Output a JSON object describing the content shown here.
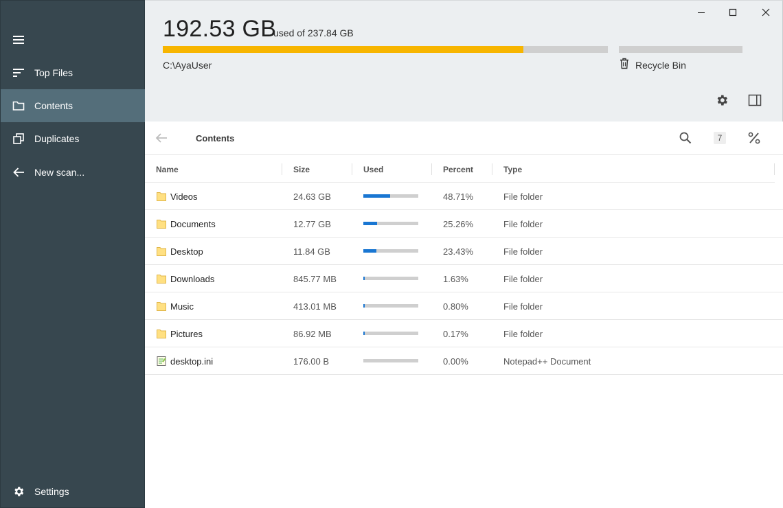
{
  "sidebar": {
    "menu_icon": "hamburger-menu-icon",
    "items": [
      {
        "label": "Top Files",
        "icon": "sort-lines-icon"
      },
      {
        "label": "Contents",
        "icon": "folder-outline-icon",
        "active": true
      },
      {
        "label": "Duplicates",
        "icon": "duplicate-icon"
      },
      {
        "label": "New scan...",
        "icon": "arrow-left-icon"
      }
    ],
    "settings_label": "Settings"
  },
  "header": {
    "used": "192.53 GB",
    "of_total": "used of 237.84 GB",
    "usage_fraction": 0.8095,
    "path": "C:\\AyaUser",
    "recycle_label": "Recycle Bin",
    "recycle_fraction": 0.0
  },
  "toolbar": {
    "title": "Contents",
    "count": "7"
  },
  "table": {
    "columns": [
      "Name",
      "Size",
      "Used",
      "Percent",
      "Type"
    ],
    "rows": [
      {
        "name": "Videos",
        "size": "24.63 GB",
        "used": 0.4871,
        "percent": "48.71%",
        "type": "File folder",
        "icon": "folder-icon"
      },
      {
        "name": "Documents",
        "size": "12.77 GB",
        "used": 0.2526,
        "percent": "25.26%",
        "type": "File folder",
        "icon": "folder-icon"
      },
      {
        "name": "Desktop",
        "size": "11.84 GB",
        "used": 0.2343,
        "percent": "23.43%",
        "type": "File folder",
        "icon": "folder-icon"
      },
      {
        "name": "Downloads",
        "size": "845.77 MB",
        "used": 0.0163,
        "percent": "1.63%",
        "type": "File folder",
        "icon": "folder-icon"
      },
      {
        "name": "Music",
        "size": "413.01 MB",
        "used": 0.008,
        "percent": "0.80%",
        "type": "File folder",
        "icon": "folder-icon"
      },
      {
        "name": "Pictures",
        "size": "86.92 MB",
        "used": 0.0017,
        "percent": "0.17%",
        "type": "File folder",
        "icon": "folder-icon"
      },
      {
        "name": "desktop.ini",
        "size": "176.00 B",
        "used": 0.0,
        "percent": "0.00%",
        "type": "Notepad++ Document",
        "icon": "notepad-document-icon"
      }
    ]
  },
  "colors": {
    "sidebar_bg": "#37474f",
    "sidebar_active": "#546e7a",
    "header_bg": "#eceff1",
    "usage_bar": "#f7b500",
    "used_bar": "#1976d2",
    "track": "#cfcfcf"
  }
}
